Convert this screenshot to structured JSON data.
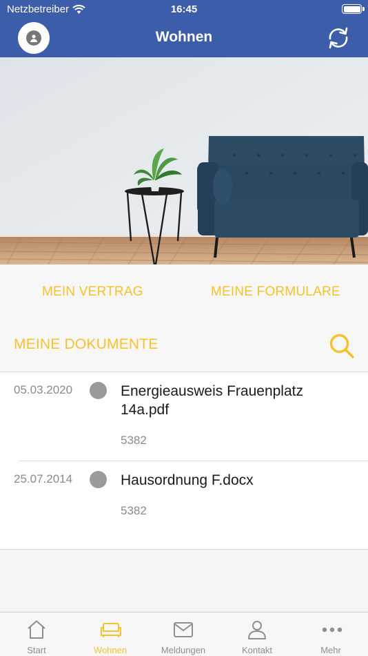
{
  "status_bar": {
    "carrier": "Netzbetreiber",
    "time": "16:45"
  },
  "header": {
    "title": "Wohnen"
  },
  "quicklinks": {
    "contract": "MEIN VERTRAG",
    "forms": "MEINE FORMULARE"
  },
  "documents": {
    "title": "MEINE DOKUMENTE",
    "items": [
      {
        "date": "05.03.2020",
        "name": "Energieausweis Frauenplatz 14a.pdf",
        "id": "5382"
      },
      {
        "date": "25.07.2014",
        "name": "Hausordnung F.docx",
        "id": "5382"
      }
    ]
  },
  "tabs": [
    {
      "label": "Start",
      "icon": "house-icon"
    },
    {
      "label": "Wohnen",
      "icon": "sofa-icon",
      "active": true
    },
    {
      "label": "Meldungen",
      "icon": "envelope-icon"
    },
    {
      "label": "Kontakt",
      "icon": "person-icon"
    },
    {
      "label": "Mehr",
      "icon": "more-dots-icon"
    }
  ],
  "colors": {
    "header": "#3c5daa",
    "accent": "#f7c12c",
    "dot": "#9a9a9a"
  }
}
